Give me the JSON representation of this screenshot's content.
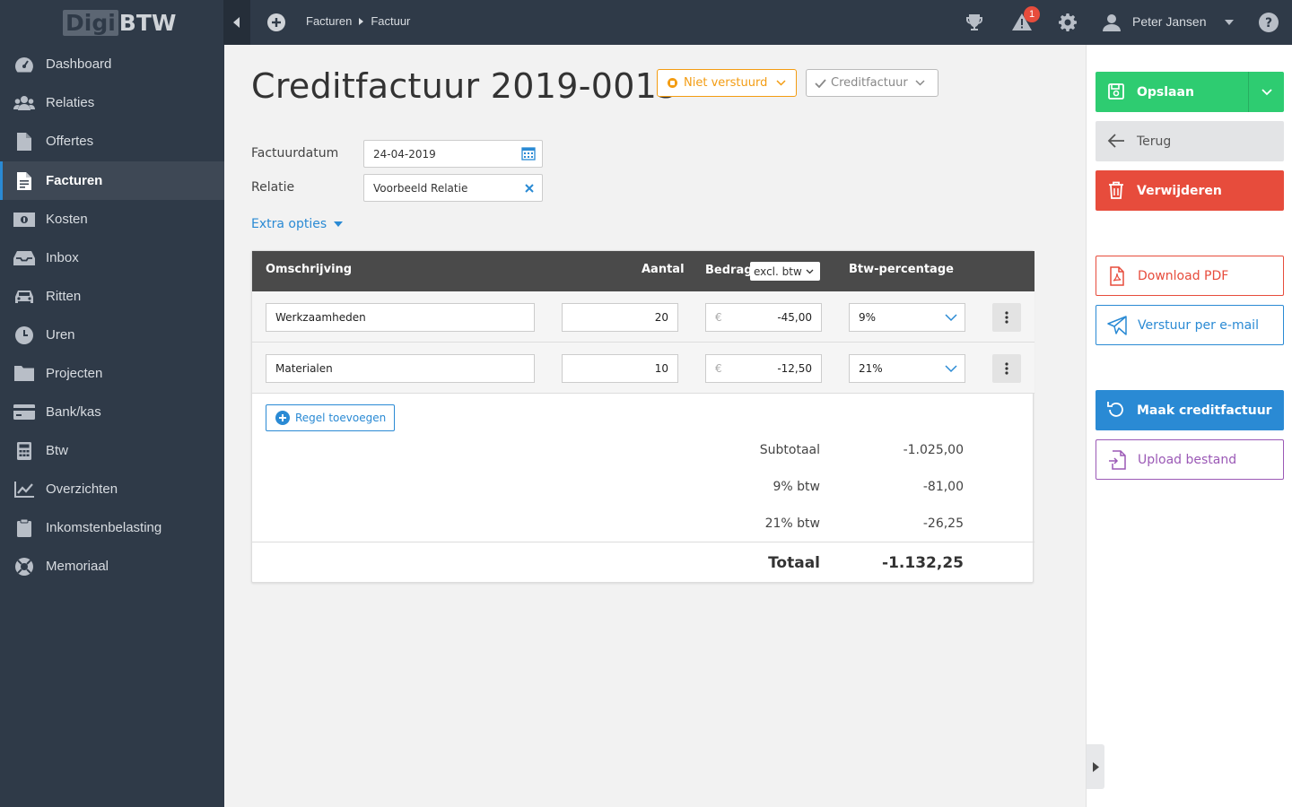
{
  "app": {
    "logo_part1": "Digi",
    "logo_part2": "BTW"
  },
  "breadcrumb": [
    "Facturen",
    "Factuur"
  ],
  "topbar": {
    "notification_count": "1",
    "user_name": "Peter Jansen"
  },
  "sidebar": {
    "items": [
      {
        "label": "Dashboard",
        "icon": "dashboard-icon"
      },
      {
        "label": "Relaties",
        "icon": "users-icon"
      },
      {
        "label": "Offertes",
        "icon": "file-icon"
      },
      {
        "label": "Facturen",
        "icon": "invoice-icon",
        "active": true
      },
      {
        "label": "Kosten",
        "icon": "money-icon"
      },
      {
        "label": "Inbox",
        "icon": "inbox-icon"
      },
      {
        "label": "Ritten",
        "icon": "car-icon"
      },
      {
        "label": "Uren",
        "icon": "clock-icon"
      },
      {
        "label": "Projecten",
        "icon": "folder-icon"
      },
      {
        "label": "Bank/kas",
        "icon": "credit-card-icon"
      },
      {
        "label": "Btw",
        "icon": "calculator-icon"
      },
      {
        "label": "Overzichten",
        "icon": "chart-icon"
      },
      {
        "label": "Inkomstenbelasting",
        "icon": "clipboard-icon"
      },
      {
        "label": "Memoriaal",
        "icon": "life-ring-icon"
      }
    ]
  },
  "invoice": {
    "title": "Creditfactuur 2019-0015",
    "status": "Niet verstuurd",
    "type": "Creditfactuur",
    "date_label": "Factuurdatum",
    "date_value": "24-04-2019",
    "relation_label": "Relatie",
    "relation_value": "Voorbeeld Relatie",
    "extra_options": "Extra opties"
  },
  "table": {
    "headers": {
      "description": "Omschrijving",
      "quantity": "Aantal",
      "amount": "Bedrag",
      "amount_mode": "excl. btw",
      "vat": "Btw-percentage"
    },
    "rows": [
      {
        "description": "Werkzaamheden",
        "quantity": "20",
        "currency": "€",
        "amount": "-45,00",
        "vat": "9%"
      },
      {
        "description": "Materialen",
        "quantity": "10",
        "currency": "€",
        "amount": "-12,50",
        "vat": "21%"
      }
    ],
    "add_line": "Regel toevoegen"
  },
  "totals": {
    "subtotal_label": "Subtotaal",
    "subtotal": "-1.025,00",
    "vat9_label": "9% btw",
    "vat9": "-81,00",
    "vat21_label": "21% btw",
    "vat21": "-26,25",
    "total_label": "Totaal",
    "total": "-1.132,25"
  },
  "actions": {
    "save": "Opslaan",
    "back": "Terug",
    "delete": "Verwijderen",
    "download_pdf": "Download PDF",
    "send_email": "Verstuur per e-mail",
    "make_credit": "Maak creditfactuur",
    "upload": "Upload bestand"
  }
}
